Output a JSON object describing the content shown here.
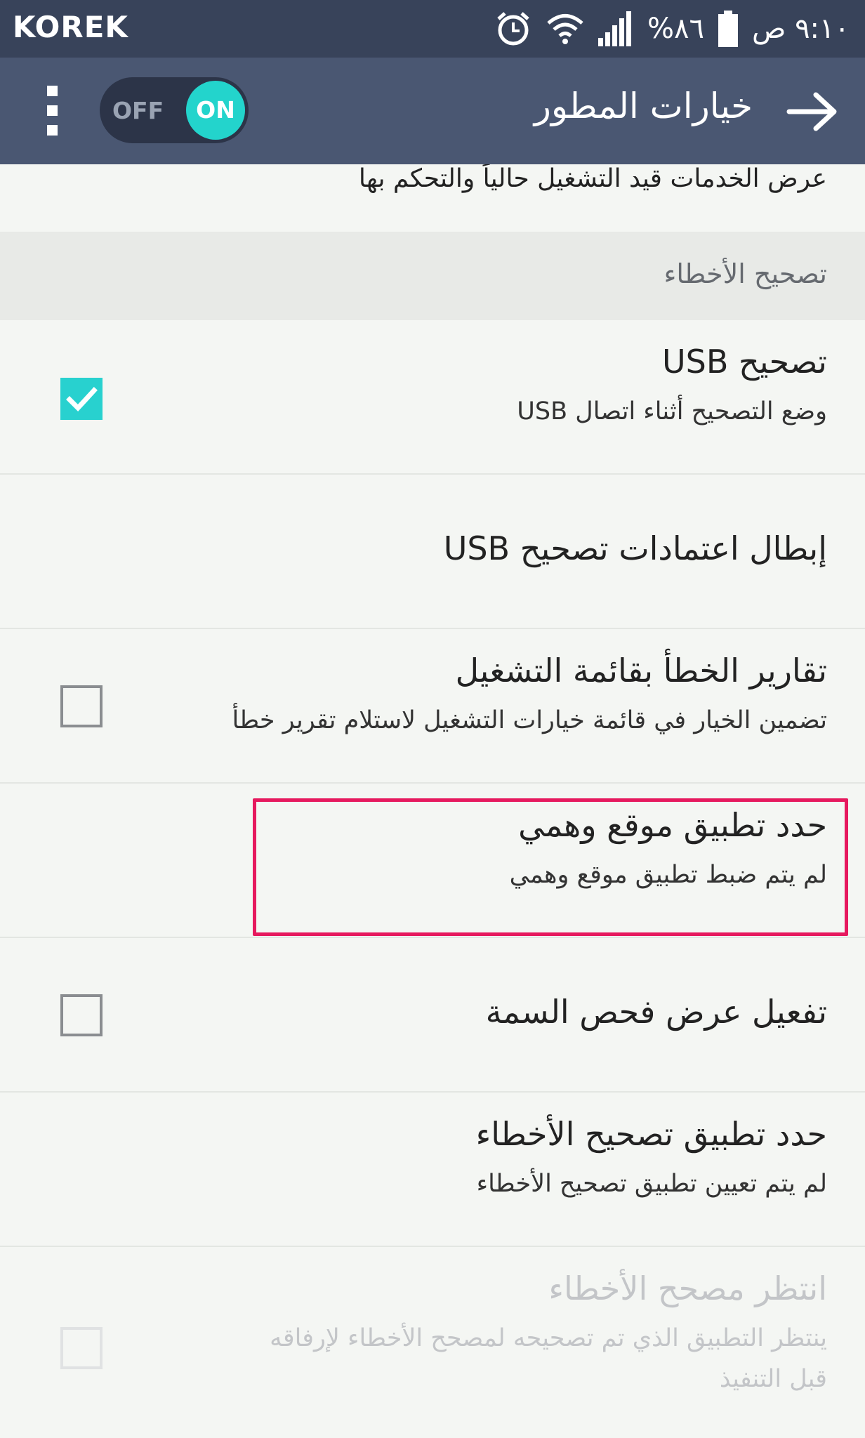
{
  "status_bar": {
    "carrier": "KOREK",
    "battery": "%٨٦",
    "time": "٩:١٠ ص",
    "icons": [
      "alarm-icon",
      "wifi-icon",
      "signal-icon",
      "battery-icon"
    ]
  },
  "app_bar": {
    "title": "خيارات المطور",
    "toggle_off_label": "OFF",
    "toggle_on_label": "ON",
    "toggle_state": "on",
    "accent_color": "#23d4cc",
    "icons": [
      "overflow-menu-icon",
      "back-arrow-icon"
    ]
  },
  "list": {
    "running_services_subtitle": "عرض الخدمات قيد التشغيل حالياً والتحكم بها",
    "section_debugging": "تصحيح الأخطاء",
    "usb_debugging": {
      "title": "تصحيح USB",
      "subtitle": "وضع التصحيح أثناء اتصال USB",
      "checked": true
    },
    "revoke_usb": {
      "title": "إبطال اعتمادات تصحيح USB"
    },
    "bug_report": {
      "title": "تقارير الخطأ بقائمة التشغيل",
      "subtitle": "تضمين الخيار في قائمة خيارات التشغيل لاستلام تقرير خطأ",
      "checked": false
    },
    "mock_location": {
      "title": "حدد تطبيق موقع وهمي",
      "subtitle": "لم يتم ضبط تطبيق موقع وهمي"
    },
    "attribute_inspection": {
      "title": "تفعيل عرض فحص السمة",
      "checked": false
    },
    "debug_app": {
      "title": "حدد تطبيق تصحيح الأخطاء",
      "subtitle": "لم يتم تعيين تطبيق تصحيح الأخطاء"
    },
    "wait_debugger": {
      "title": "انتظر مصحح الأخطاء",
      "subtitle_line1": "ينتظر التطبيق الذي تم تصحيحه لمصحح الأخطاء لإرفاقه",
      "subtitle_line2": "قبل التنفيذ",
      "enabled": false
    }
  },
  "highlight_color": "#e6195e"
}
